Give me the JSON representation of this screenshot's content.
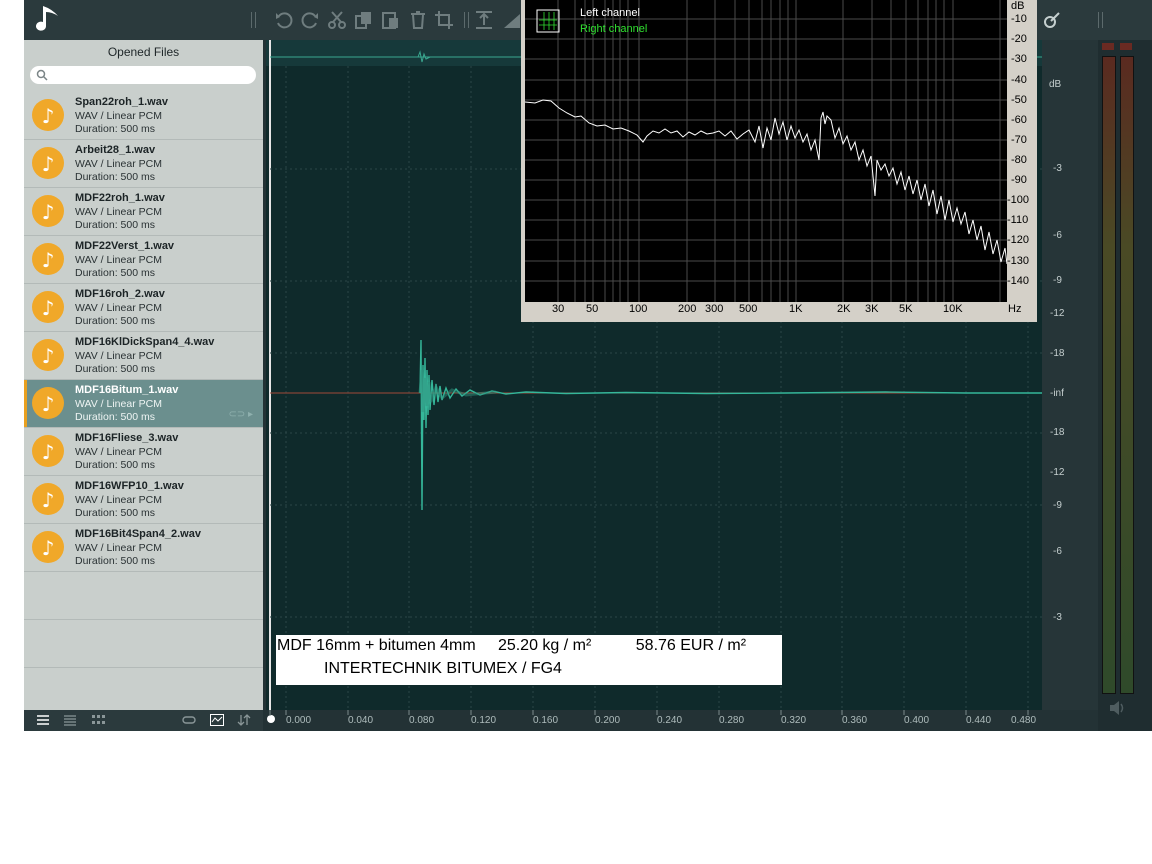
{
  "sidebar": {
    "title": "Opened Files",
    "search_placeholder": "",
    "files": [
      {
        "name": "Span22roh_1.wav",
        "format": "WAV / Linear PCM",
        "duration": "Duration: 500 ms"
      },
      {
        "name": "Arbeit28_1.wav",
        "format": "WAV / Linear PCM",
        "duration": "Duration: 500 ms"
      },
      {
        "name": "MDF22roh_1.wav",
        "format": "WAV / Linear PCM",
        "duration": "Duration: 500 ms"
      },
      {
        "name": "MDF22Verst_1.wav",
        "format": "WAV / Linear PCM",
        "duration": "Duration: 500 ms"
      },
      {
        "name": "MDF16roh_2.wav",
        "format": "WAV / Linear PCM",
        "duration": "Duration: 500 ms"
      },
      {
        "name": "MDF16KlDickSpan4_4.wav",
        "format": "WAV / Linear PCM",
        "duration": "Duration: 500 ms"
      },
      {
        "name": "MDF16Bitum_1.wav",
        "format": "WAV / Linear PCM",
        "duration": "Duration: 500 ms",
        "selected": true
      },
      {
        "name": "MDF16Fliese_3.wav",
        "format": "WAV / Linear PCM",
        "duration": "Duration: 500 ms"
      },
      {
        "name": "MDF16WFP10_1.wav",
        "format": "WAV / Linear PCM",
        "duration": "Duration: 500 ms"
      },
      {
        "name": "MDF16Bit4Span4_2.wav",
        "format": "WAV / Linear PCM",
        "duration": "Duration: 500 ms"
      }
    ]
  },
  "toolbar": {
    "icons": [
      "undo-icon",
      "redo-icon",
      "cut-icon",
      "copy-icon",
      "paste-icon",
      "delete-icon",
      "crop-icon",
      "normalize-icon"
    ]
  },
  "timeline": {
    "ticks": [
      "0.000",
      "0.040",
      "0.080",
      "0.120",
      "0.160",
      "0.200",
      "0.240",
      "0.280",
      "0.320",
      "0.360",
      "0.400",
      "0.440",
      "0.480"
    ]
  },
  "level_scale": {
    "unit": "dB",
    "labels": [
      "-3",
      "-6",
      "-9",
      "-12",
      "-18",
      "-inf",
      "-18",
      "-12",
      "-9",
      "-6",
      "-3"
    ]
  },
  "caption": {
    "line1": "MDF 16mm + bitumen 4mm     25.20 kg / m²          58.76 EUR / m²",
    "line2": "INTERTECHNIK BITUMEX / FG4"
  },
  "spectrum": {
    "legend": {
      "left": "Left channel",
      "right": "Right channel"
    },
    "db_unit": "dB",
    "db_ticks": [
      "-10",
      "-20",
      "-30",
      "-40",
      "-50",
      "-60",
      "-70",
      "-80",
      "-90",
      "-100",
      "-110",
      "-120",
      "-130",
      "-140"
    ],
    "hz_unit": "Hz",
    "hz_ticks": [
      "30",
      "50",
      "100",
      "200",
      "300",
      "500",
      "1K",
      "2K",
      "3K",
      "5K",
      "10K"
    ],
    "colors": {
      "left": "#ffffff",
      "right": "#30e030"
    }
  }
}
